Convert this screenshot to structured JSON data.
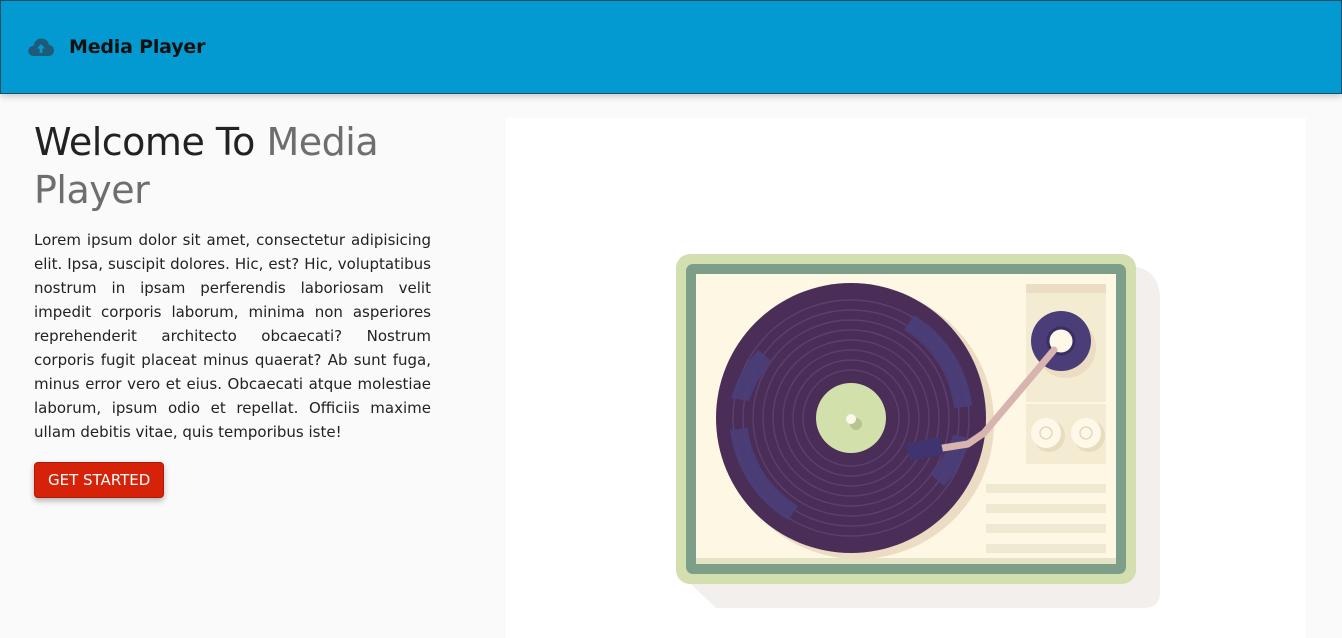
{
  "navbar": {
    "brand_icon": "cloud-upload-icon",
    "brand_title": "Media Player",
    "background_color": "#039ad1"
  },
  "hero": {
    "headline_prefix": "Welcome To ",
    "headline_accent": "Media Player",
    "description": "Lorem ipsum dolor sit amet, consectetur adipisicing elit. Ipsa, suscipit dolores. Hic, est? Hic, voluptatibus nostrum in ipsam perferendis laboriosam velit impedit corporis laborum, minima non asperiores reprehenderit architecto obcaecati? Nostrum corporis fugit placeat minus quaerat? Ab sunt fuga, minus error vero et eius. Obcaecati atque molestiae laborum, ipsum odio et repellat. Officiis maxime ullam debitis vitae, quis temporibus iste!",
    "cta_label": "GET STARTED",
    "cta_color": "#d7220a",
    "illustration": "record-player-illustration"
  }
}
